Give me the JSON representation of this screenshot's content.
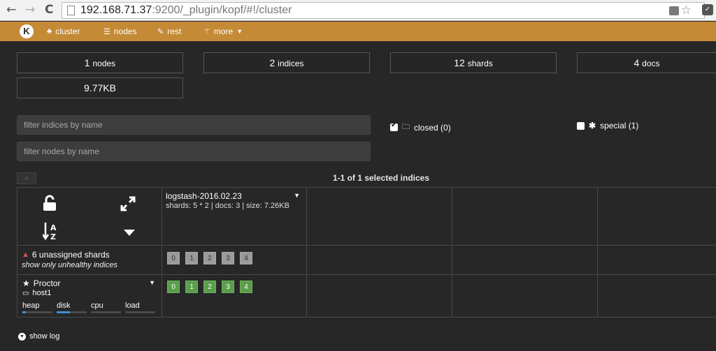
{
  "browser": {
    "back": "←",
    "forward": "→",
    "reload": "C",
    "url_host": "192.168.71.37",
    "url_rest": ":9200/_plugin/kopf/#!/cluster",
    "star": "☆"
  },
  "navbar": {
    "logo": "K",
    "items": [
      {
        "label": "cluster",
        "icon": "sitemap-icon"
      },
      {
        "label": "nodes",
        "icon": "list-icon"
      },
      {
        "label": "rest",
        "icon": "edit-icon"
      },
      {
        "label": "more",
        "icon": "magic-wand-icon"
      }
    ],
    "bg_color": "#c48a35"
  },
  "stats": {
    "nodes_count": "1",
    "nodes_label": "nodes",
    "indices_count": "2",
    "indices_label": "indices",
    "shards_count": "12",
    "shards_label": "shards",
    "docs_count": "4",
    "docs_label": "docs",
    "size": "9.77KB"
  },
  "filters": {
    "indices_placeholder": "filter indices by name",
    "nodes_placeholder": "filter nodes by name",
    "closed_label": "closed (0)",
    "closed_checked": true,
    "special_label": "special (1)",
    "special_checked": false
  },
  "pagination": {
    "prev": "«",
    "summary": "1-1 of 1 selected indices"
  },
  "index": {
    "name": "logstash-2016.02.23",
    "meta": "shards: 5 * 2 | docs: 3 | size: 7.26KB"
  },
  "unassigned": {
    "warning": "6 unassigned shards",
    "link": "show only unhealthy indices",
    "shards": [
      "0",
      "1",
      "2",
      "3",
      "4"
    ]
  },
  "node": {
    "name": "Proctor",
    "host": "host1",
    "shards": [
      "0",
      "1",
      "2",
      "3",
      "4"
    ],
    "metrics": [
      {
        "label": "heap",
        "fill": 0.12
      },
      {
        "label": "disk",
        "fill": 0.45
      },
      {
        "label": "cpu",
        "fill": 0
      },
      {
        "label": "load",
        "fill": 0
      }
    ]
  },
  "footer": {
    "show_log": "show log"
  },
  "colors": {
    "shard_started": "#5a9e4b",
    "shard_unassigned": "#9a9a9a",
    "warning": "#e05050",
    "metric_fill": "#3f8fd8"
  }
}
